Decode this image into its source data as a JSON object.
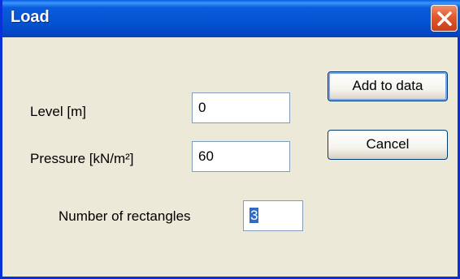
{
  "window": {
    "title": "Load"
  },
  "fields": {
    "level": {
      "label": "Level [m]",
      "value": "0"
    },
    "pressure": {
      "label": "Pressure [kN/m²]",
      "value": "60"
    },
    "rectangles": {
      "label": "Number of rectangles",
      "value": "3"
    }
  },
  "buttons": {
    "add_label": "Add to data",
    "cancel_label": "Cancel"
  },
  "icons": {
    "close": "close-icon"
  },
  "colors": {
    "titlebar": "#0453d2",
    "close": "#e3572b",
    "face": "#ece9d8",
    "selection": "#316ac5"
  }
}
